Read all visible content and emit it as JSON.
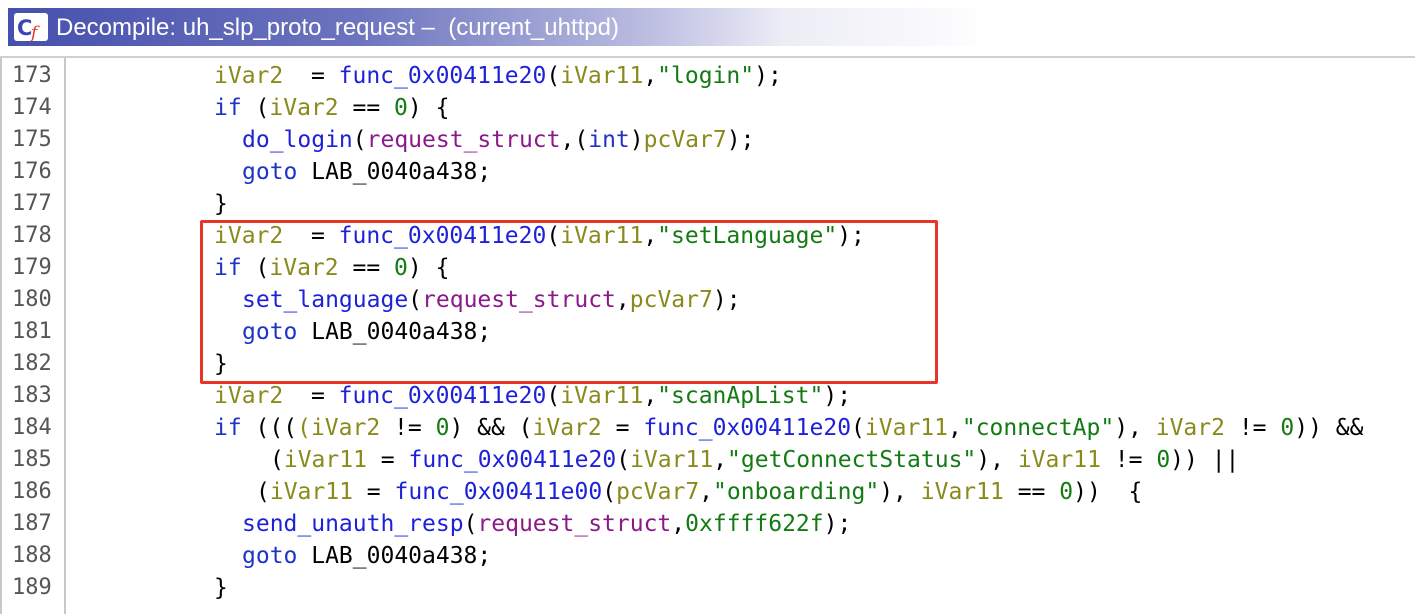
{
  "window": {
    "title": "Decompile: uh_slp_proto_request –  (current_uhttpd)",
    "icon": "decompile-icon"
  },
  "code_lines": [
    {
      "n": "173",
      "indent": 0,
      "parts": [
        [
          "var",
          "iVar2"
        ],
        [
          "",
          "  = "
        ],
        [
          "fn",
          "func_0x00411e20"
        ],
        [
          "",
          "("
        ],
        [
          "var",
          "iVar11"
        ],
        [
          "",
          ","
        ],
        [
          "str",
          "\"login\""
        ],
        [
          "",
          ");"
        ]
      ]
    },
    {
      "n": "174",
      "indent": 0,
      "parts": [
        [
          "kw",
          "if"
        ],
        [
          "",
          " ("
        ],
        [
          "var",
          "iVar2"
        ],
        [
          "",
          " == "
        ],
        [
          "num",
          "0"
        ],
        [
          "",
          ") {"
        ]
      ]
    },
    {
      "n": "175",
      "indent": 1,
      "parts": [
        [
          "fn",
          "do_login"
        ],
        [
          "",
          "("
        ],
        [
          "param",
          "request_struct"
        ],
        [
          "",
          ",("
        ],
        [
          "typ",
          "int"
        ],
        [
          "",
          ")"
        ],
        [
          "var",
          "pcVar7"
        ],
        [
          "",
          ");"
        ]
      ]
    },
    {
      "n": "176",
      "indent": 1,
      "parts": [
        [
          "kw",
          "goto"
        ],
        [
          "",
          " LAB_0040a438;"
        ]
      ]
    },
    {
      "n": "177",
      "indent": 0,
      "parts": [
        [
          "",
          "}"
        ]
      ]
    },
    {
      "n": "178",
      "indent": 0,
      "parts": [
        [
          "var",
          "iVar2"
        ],
        [
          "",
          "  = "
        ],
        [
          "fn",
          "func_0x00411e20"
        ],
        [
          "",
          "("
        ],
        [
          "var",
          "iVar11"
        ],
        [
          "",
          ","
        ],
        [
          "str",
          "\"setLanguage\""
        ],
        [
          "",
          ");"
        ]
      ]
    },
    {
      "n": "179",
      "indent": 0,
      "parts": [
        [
          "kw",
          "if"
        ],
        [
          "",
          " ("
        ],
        [
          "var",
          "iVar2"
        ],
        [
          "",
          " == "
        ],
        [
          "num",
          "0"
        ],
        [
          "",
          ") {"
        ]
      ]
    },
    {
      "n": "180",
      "indent": 1,
      "parts": [
        [
          "fn",
          "set_language"
        ],
        [
          "",
          "("
        ],
        [
          "param",
          "request_struct"
        ],
        [
          "",
          ","
        ],
        [
          "var",
          "pcVar7"
        ],
        [
          "",
          ");"
        ]
      ]
    },
    {
      "n": "181",
      "indent": 1,
      "parts": [
        [
          "kw",
          "goto"
        ],
        [
          "",
          " LAB_0040a438;"
        ]
      ]
    },
    {
      "n": "182",
      "indent": 0,
      "parts": [
        [
          "",
          "}"
        ]
      ]
    },
    {
      "n": "183",
      "indent": 0,
      "parts": [
        [
          "var",
          "iVar2"
        ],
        [
          "",
          "  = "
        ],
        [
          "fn",
          "func_0x00411e20"
        ],
        [
          "",
          "("
        ],
        [
          "var",
          "iVar11"
        ],
        [
          "",
          ","
        ],
        [
          "str",
          "\"scanApList\""
        ],
        [
          "",
          ");"
        ]
      ]
    },
    {
      "n": "184",
      "indent": 0,
      "parts": [
        [
          "kw",
          "if"
        ],
        [
          "",
          " ((("
        ],
        [
          "var",
          "(iVar2"
        ],
        [
          "",
          " != "
        ],
        [
          "num",
          "0"
        ],
        [
          "",
          ") && ("
        ],
        [
          "var",
          "iVar2"
        ],
        [
          "",
          " = "
        ],
        [
          "fn",
          "func_0x00411e20"
        ],
        [
          "",
          "("
        ],
        [
          "var",
          "iVar11"
        ],
        [
          "",
          ","
        ],
        [
          "str",
          "\"connectAp\""
        ],
        [
          "",
          "), "
        ],
        [
          "var",
          "iVar2"
        ],
        [
          "",
          " != "
        ],
        [
          "num",
          "0"
        ],
        [
          "",
          ")) &&"
        ]
      ]
    },
    {
      "n": "185",
      "indent": 2,
      "parts": [
        [
          "",
          "("
        ],
        [
          "var",
          "iVar11"
        ],
        [
          "",
          " = "
        ],
        [
          "fn",
          "func_0x00411e20"
        ],
        [
          "",
          "("
        ],
        [
          "var",
          "iVar11"
        ],
        [
          "",
          ","
        ],
        [
          "str",
          "\"getConnectStatus\""
        ],
        [
          "",
          "), "
        ],
        [
          "var",
          "iVar11"
        ],
        [
          "",
          " != "
        ],
        [
          "num",
          "0"
        ],
        [
          "",
          ")) ||"
        ]
      ]
    },
    {
      "n": "186",
      "indent": 3,
      "parts": [
        [
          "",
          "("
        ],
        [
          "var",
          "iVar11"
        ],
        [
          "",
          " = "
        ],
        [
          "fn",
          "func_0x00411e00"
        ],
        [
          "",
          "("
        ],
        [
          "var",
          "pcVar7"
        ],
        [
          "",
          ","
        ],
        [
          "str",
          "\"onboarding\""
        ],
        [
          "",
          "), "
        ],
        [
          "var",
          "iVar11"
        ],
        [
          "",
          " == "
        ],
        [
          "num",
          "0"
        ],
        [
          "",
          "))  {"
        ]
      ]
    },
    {
      "n": "187",
      "indent": 1,
      "parts": [
        [
          "fn",
          "send_unauth_resp"
        ],
        [
          "",
          "("
        ],
        [
          "param",
          "request_struct"
        ],
        [
          "",
          ","
        ],
        [
          "num",
          "0xffff622f"
        ],
        [
          "",
          ");"
        ]
      ]
    },
    {
      "n": "188",
      "indent": 1,
      "parts": [
        [
          "kw",
          "goto"
        ],
        [
          "",
          " LAB_0040a438;"
        ]
      ]
    },
    {
      "n": "189",
      "indent": 0,
      "parts": [
        [
          "",
          "}"
        ]
      ]
    }
  ],
  "highlight": {
    "from_line": "178",
    "to_line": "182",
    "color": "#e8352a"
  }
}
